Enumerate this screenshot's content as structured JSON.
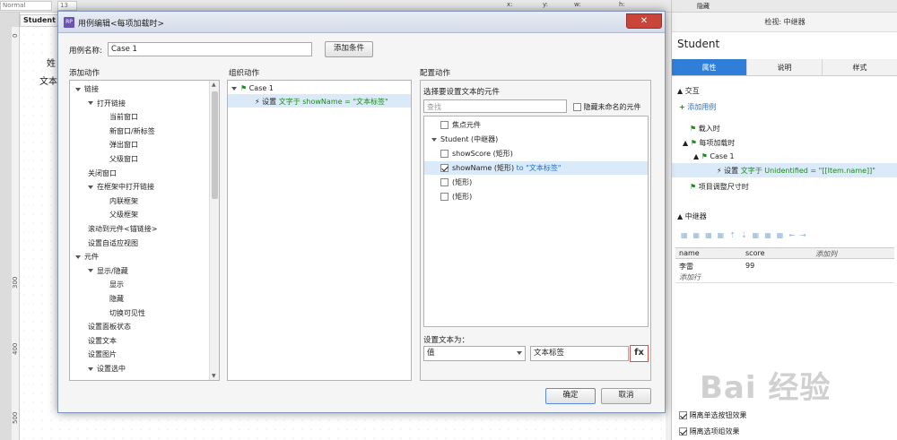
{
  "background": {
    "toolbar": {
      "font_size": "13",
      "style_field": "Normal",
      "x_label": "x:",
      "y_label": "y:",
      "w_label": "w:",
      "h_label": "h:",
      "hidden_label": "隐藏"
    },
    "canvas_tab": "Student",
    "canvas_text1": "姓",
    "canvas_text2": "文本",
    "ruler_ticks": [
      "300",
      "400",
      "500"
    ],
    "ruler_top": "0"
  },
  "right_panel": {
    "header": "检视: 中继器",
    "title": "Student",
    "tabs": [
      {
        "label": "属性",
        "active": true
      },
      {
        "label": "说明",
        "active": false
      },
      {
        "label": "样式",
        "active": false
      }
    ],
    "interaction_section": "交互",
    "add_case_link": "添加用例",
    "events": [
      {
        "label": "载入时"
      },
      {
        "label": "每项加载时"
      },
      {
        "label": "Case 1"
      },
      {
        "label": "设置",
        "detail": "文字于 Unidentified = \"[[Item.name]]\""
      },
      {
        "label": "项目调整尺寸时"
      }
    ],
    "repeater_section": "中继器",
    "grid_columns": [
      "name",
      "score",
      "添加列"
    ],
    "grid_row": {
      "name": "李雷",
      "score": "99"
    },
    "add_row": "添加行",
    "option1": "隔离单选按钮效果",
    "option2": "隔离选项组效果"
  },
  "watermark": "Bai 经验",
  "dialog": {
    "title": "用例编辑<每项加载时>",
    "close_symbol": "✕",
    "case_name_label": "用例名称:",
    "case_name_value": "Case 1",
    "add_condition_button": "添加条件",
    "col1_header": "添加动作",
    "col2_header": "组织动作",
    "col3_header": "配置动作",
    "actions_tree": [
      {
        "label": "链接",
        "level": 0,
        "arrow": true
      },
      {
        "label": "打开链接",
        "level": 1,
        "arrow": true
      },
      {
        "label": "当前窗口",
        "level": 2
      },
      {
        "label": "新窗口/新标签",
        "level": 2
      },
      {
        "label": "弹出窗口",
        "level": 2
      },
      {
        "label": "父级窗口",
        "level": 2
      },
      {
        "label": "关闭窗口",
        "level": 1
      },
      {
        "label": "在框架中打开链接",
        "level": 1,
        "arrow": true
      },
      {
        "label": "内联框架",
        "level": 2
      },
      {
        "label": "父级框架",
        "level": 2
      },
      {
        "label": "滚动到元件<锚链接>",
        "level": 1
      },
      {
        "label": "设置自适应视图",
        "level": 1
      },
      {
        "label": "元件",
        "level": 0,
        "arrow": true
      },
      {
        "label": "显示/隐藏",
        "level": 1,
        "arrow": true
      },
      {
        "label": "显示",
        "level": 2
      },
      {
        "label": "隐藏",
        "level": 2
      },
      {
        "label": "切换可见性",
        "level": 2
      },
      {
        "label": "设置面板状态",
        "level": 1
      },
      {
        "label": "设置文本",
        "level": 1
      },
      {
        "label": "设置图片",
        "level": 1
      },
      {
        "label": "设置选中",
        "level": 1,
        "arrow": true
      }
    ],
    "org_case": "Case 1",
    "org_action": {
      "verb": "设置",
      "detail": "文字于 showName = \"文本标签\""
    },
    "config_subheader": "选择要设置文本的元件",
    "search_placeholder": "查找",
    "hide_unnamed_label": "隐藏未命名的元件",
    "widgets": [
      {
        "label": "焦点元件",
        "checked": false,
        "indent": 1
      },
      {
        "label": "Student (中继器)",
        "checked": null,
        "indent": 0
      },
      {
        "label": "showScore (矩形)",
        "checked": false,
        "indent": 1
      },
      {
        "label": "showName (矩形)",
        "suffix": "to \"文本标签\"",
        "checked": true,
        "indent": 1,
        "selected": true
      },
      {
        "label": "(矩形)",
        "checked": false,
        "indent": 1
      },
      {
        "label": "(矩形)",
        "checked": false,
        "indent": 1
      }
    ],
    "set_text_label": "设置文本为：",
    "value_type": "值",
    "value_text": "文本标签",
    "fx_label": "fx",
    "ok_button": "确定",
    "cancel_button": "取消"
  }
}
